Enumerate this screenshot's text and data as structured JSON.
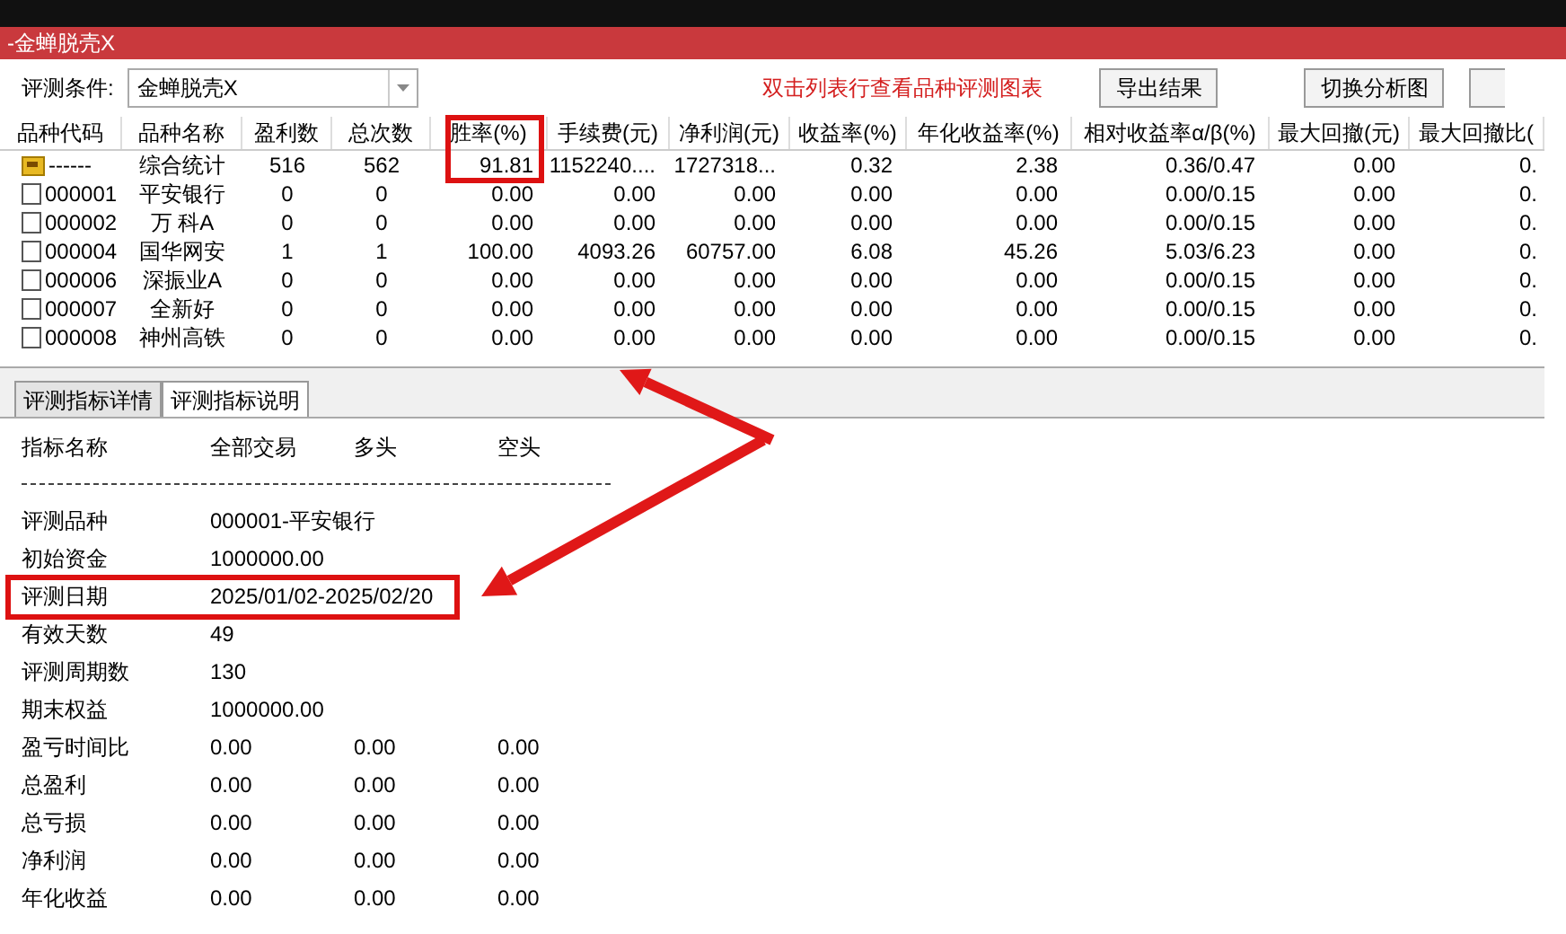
{
  "window": {
    "title": "-金蝉脱壳X"
  },
  "toolbar": {
    "condition_label": "评测条件:",
    "condition_value": "金蝉脱壳X",
    "hint": "双击列表行查看品种评测图表",
    "buttons": [
      "导出结果",
      "切换分析图"
    ]
  },
  "table": {
    "columns": [
      "品种代码",
      "品种名称",
      "盈利数",
      "总次数",
      "胜率(%)",
      "手续费(元)",
      "净利润(元)",
      "收益率(%)",
      "年化收益率(%)",
      "相对收益率α/β(%)",
      "最大回撤(元)",
      "最大回撤比("
    ],
    "rows": [
      {
        "kind": "summary",
        "cells": [
          "------",
          "综合统计",
          "516",
          "562",
          "91.81",
          "1152240....",
          "1727318...",
          "0.32",
          "2.38",
          "0.36/0.47",
          "0.00",
          "0."
        ]
      },
      {
        "kind": "stock",
        "cells": [
          "000001",
          "平安银行",
          "0",
          "0",
          "0.00",
          "0.00",
          "0.00",
          "0.00",
          "0.00",
          "0.00/0.15",
          "0.00",
          "0."
        ]
      },
      {
        "kind": "stock",
        "cells": [
          "000002",
          "万 科A",
          "0",
          "0",
          "0.00",
          "0.00",
          "0.00",
          "0.00",
          "0.00",
          "0.00/0.15",
          "0.00",
          "0."
        ]
      },
      {
        "kind": "stock",
        "cells": [
          "000004",
          "国华网安",
          "1",
          "1",
          "100.00",
          "4093.26",
          "60757.00",
          "6.08",
          "45.26",
          "5.03/6.23",
          "0.00",
          "0."
        ]
      },
      {
        "kind": "stock",
        "cells": [
          "000006",
          "深振业A",
          "0",
          "0",
          "0.00",
          "0.00",
          "0.00",
          "0.00",
          "0.00",
          "0.00/0.15",
          "0.00",
          "0."
        ]
      },
      {
        "kind": "stock",
        "cells": [
          "000007",
          "全新好",
          "0",
          "0",
          "0.00",
          "0.00",
          "0.00",
          "0.00",
          "0.00",
          "0.00/0.15",
          "0.00",
          "0."
        ]
      },
      {
        "kind": "stock",
        "cells": [
          "000008",
          "神州高铁",
          "0",
          "0",
          "0.00",
          "0.00",
          "0.00",
          "0.00",
          "0.00",
          "0.00/0.15",
          "0.00",
          "0."
        ]
      }
    ]
  },
  "tabs": [
    {
      "label": "评测指标详情",
      "selected": true
    },
    {
      "label": "评测指标说明",
      "selected": false
    }
  ],
  "details": {
    "columns": [
      "指标名称",
      "全部交易",
      "多头",
      "空头"
    ],
    "rows": [
      {
        "label": "评测品种",
        "values": [
          "000001-平安银行"
        ]
      },
      {
        "label": "初始资金",
        "values": [
          "1000000.00"
        ]
      },
      {
        "label": "评测日期",
        "values": [
          "2025/01/02-2025/02/20"
        ]
      },
      {
        "label": "有效天数",
        "values": [
          "49"
        ]
      },
      {
        "label": "评测周期数",
        "values": [
          "130"
        ]
      },
      {
        "label": "期末权益",
        "values": [
          "1000000.00"
        ]
      },
      {
        "label": "盈亏时间比",
        "values": [
          "0.00",
          "0.00",
          "0.00"
        ]
      },
      {
        "label": "总盈利",
        "values": [
          "0.00",
          "0.00",
          "0.00"
        ]
      },
      {
        "label": "总亏损",
        "values": [
          "0.00",
          "0.00",
          "0.00"
        ]
      },
      {
        "label": "净利润",
        "values": [
          "0.00",
          "0.00",
          "0.00"
        ]
      },
      {
        "label": "年化收益",
        "values": [
          "0.00",
          "0.00",
          "0.00"
        ]
      }
    ]
  }
}
